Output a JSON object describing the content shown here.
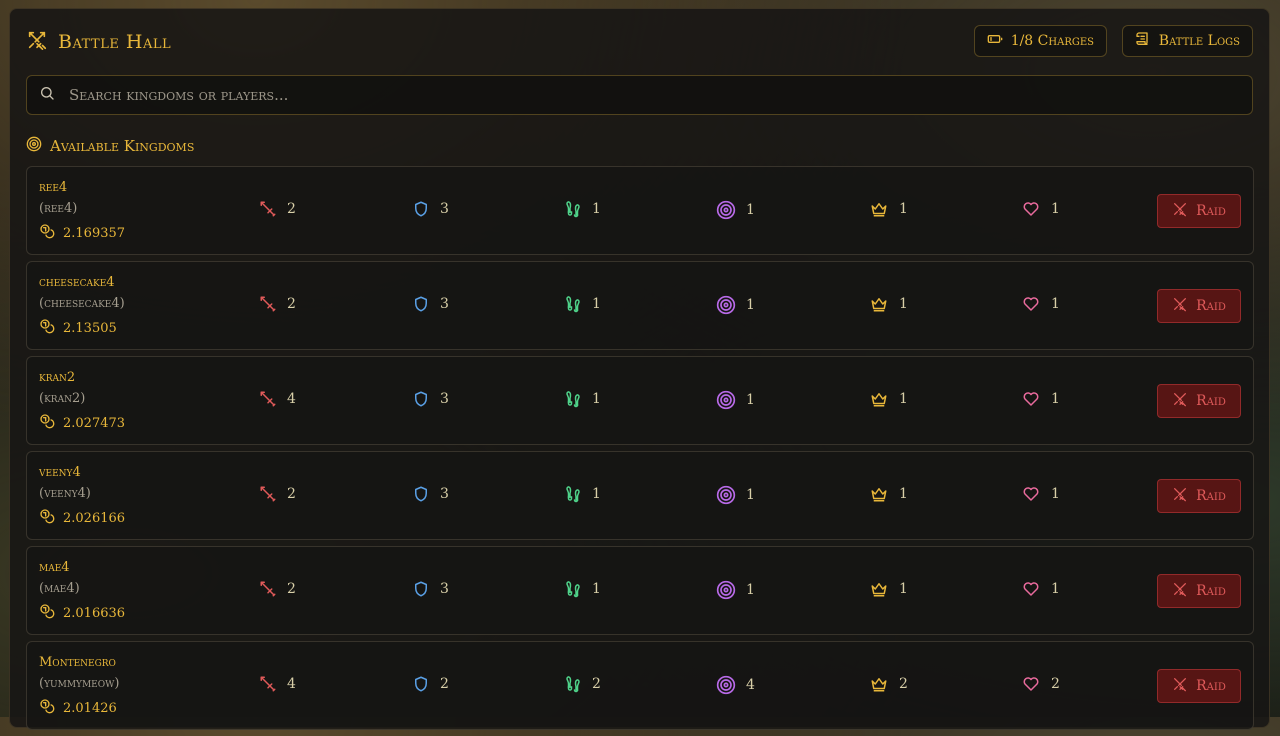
{
  "header": {
    "title": "Battle Hall",
    "charges_label": "1/8 Charges",
    "logs_label": "Battle Logs"
  },
  "search": {
    "placeholder": "Search kingdoms or players..."
  },
  "section": {
    "title": "Available Kingdoms"
  },
  "raid_label": "Raid",
  "colors": {
    "gold": "#e8b73a",
    "attack": "#e05a5a",
    "defense": "#5aa0e6",
    "speed": "#4fd38a",
    "accuracy": "#b86ae8",
    "leadership": "#e8b73a",
    "health": "#e86a9c"
  },
  "icons": {
    "title": "crossed-swords-icon",
    "charges": "battery-icon",
    "logs": "scroll-icon",
    "search": "search-icon",
    "section": "target-icon",
    "value": "coins-icon",
    "attack": "sword-icon",
    "defense": "shield-icon",
    "speed": "footprints-icon",
    "accuracy": "target-icon",
    "leadership": "crown-icon",
    "health": "heart-icon",
    "raid": "crossed-swords-icon"
  },
  "kingdoms": [
    {
      "name": "ree4",
      "player": "(ree4)",
      "value": "2.169357",
      "attack": "2",
      "defense": "3",
      "speed": "1",
      "accuracy": "1",
      "leadership": "1",
      "health": "1"
    },
    {
      "name": "cheesecake4",
      "player": "(cheesecake4)",
      "value": "2.13505",
      "attack": "2",
      "defense": "3",
      "speed": "1",
      "accuracy": "1",
      "leadership": "1",
      "health": "1"
    },
    {
      "name": "kran2",
      "player": "(kran2)",
      "value": "2.027473",
      "attack": "4",
      "defense": "3",
      "speed": "1",
      "accuracy": "1",
      "leadership": "1",
      "health": "1"
    },
    {
      "name": "veeny4",
      "player": "(veeny4)",
      "value": "2.026166",
      "attack": "2",
      "defense": "3",
      "speed": "1",
      "accuracy": "1",
      "leadership": "1",
      "health": "1"
    },
    {
      "name": "mae4",
      "player": "(mae4)",
      "value": "2.016636",
      "attack": "2",
      "defense": "3",
      "speed": "1",
      "accuracy": "1",
      "leadership": "1",
      "health": "1"
    },
    {
      "name": "Montenegro",
      "player": "(yummymeow)",
      "value": "2.01426",
      "attack": "4",
      "defense": "2",
      "speed": "2",
      "accuracy": "4",
      "leadership": "2",
      "health": "2"
    }
  ]
}
